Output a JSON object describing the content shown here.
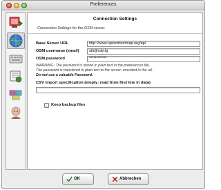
{
  "window": {
    "title": "Preferences"
  },
  "sidebar": {
    "items": [
      {
        "icon": "display-settings-icon",
        "active": false
      },
      {
        "icon": "globe-connection-icon",
        "active": true
      },
      {
        "icon": "keyboard-shortcuts-icon",
        "active": false
      },
      {
        "icon": "map-projection-icon",
        "active": false
      },
      {
        "icon": "plugins-icon",
        "active": false
      },
      {
        "icon": "advanced-preferences-icon",
        "active": false
      }
    ]
  },
  "panel": {
    "title": "Connection Settings",
    "subtitle": "Connection Settings for the OSM server.",
    "base_url_label": "Base Server URL",
    "base_url_value": "http://www.openstreetmap.org/api",
    "username_label": "OSM username (email)",
    "username_value": "sbi@cde.fg",
    "password_label": "OSM password",
    "password_value": "************",
    "warning_line1": "WARNING: The password is stored in plain text in the preferences file.",
    "warning_line2": "The password is transfered in plain text to the server, encoded in the url.",
    "warning_line3": "Do not use a valuable Password.",
    "csv_label": "CSV import specification (empty: read from first line in data)",
    "csv_value": "",
    "backup_label": "Keep backup files",
    "backup_checked": false
  },
  "buttons": {
    "ok_label": "OK",
    "cancel_label": "Abbrechen"
  }
}
